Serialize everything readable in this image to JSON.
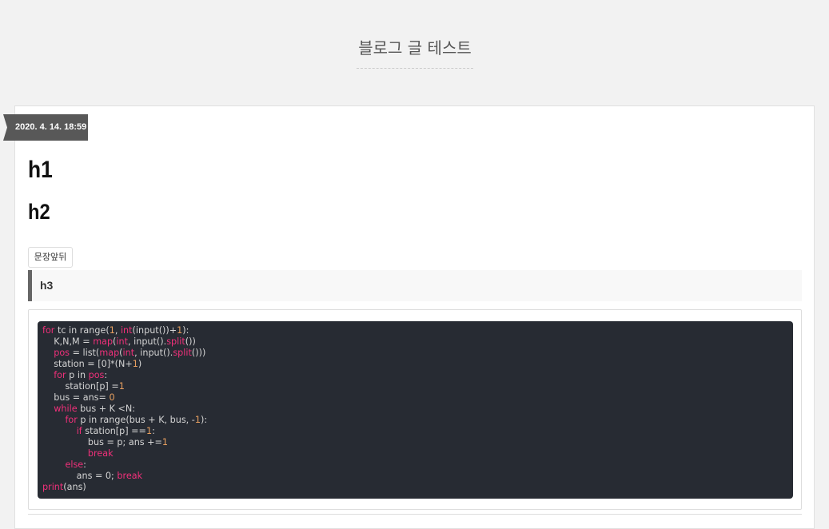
{
  "blog": {
    "title": "블로그 글 테스트"
  },
  "post": {
    "date": "2020. 4. 14. 18:59",
    "h1": "h1",
    "h2": "h2",
    "inline_text": "문장앞뒤",
    "h3": "h3"
  },
  "code": {
    "lines": [
      [
        [
          "kw",
          "for"
        ],
        [
          "t",
          " tc in range("
        ],
        [
          "num",
          "1"
        ],
        [
          "t",
          ", "
        ],
        [
          "kw",
          "int"
        ],
        [
          "t",
          "(input())+"
        ],
        [
          "num",
          "1"
        ],
        [
          "t",
          "):"
        ]
      ],
      [
        [
          "t",
          "    K,N,M = "
        ],
        [
          "kw",
          "map"
        ],
        [
          "t",
          "("
        ],
        [
          "kw",
          "int"
        ],
        [
          "t",
          ", input()."
        ],
        [
          "kw",
          "split"
        ],
        [
          "t",
          "())"
        ]
      ],
      [
        [
          "t",
          "    "
        ],
        [
          "kw",
          "pos"
        ],
        [
          "t",
          " = list("
        ],
        [
          "kw",
          "map"
        ],
        [
          "t",
          "("
        ],
        [
          "kw",
          "int"
        ],
        [
          "t",
          ", input()."
        ],
        [
          "kw",
          "split"
        ],
        [
          "t",
          "()))"
        ]
      ],
      [
        [
          "t",
          "    station = [0]*(N+"
        ],
        [
          "num",
          "1"
        ],
        [
          "t",
          ")"
        ]
      ],
      [
        [
          "t",
          "    "
        ],
        [
          "kw",
          "for"
        ],
        [
          "t",
          " p in "
        ],
        [
          "kw",
          "pos"
        ],
        [
          "t",
          ":"
        ]
      ],
      [
        [
          "t",
          "        station[p] ="
        ],
        [
          "num",
          "1"
        ]
      ],
      [
        [
          "t",
          "    bus = ans= "
        ],
        [
          "num",
          "0"
        ]
      ],
      [
        [
          "t",
          "    "
        ],
        [
          "kw",
          "while"
        ],
        [
          "t",
          " bus + K <N:"
        ]
      ],
      [
        [
          "t",
          "        "
        ],
        [
          "kw",
          "for"
        ],
        [
          "t",
          " p in range(bus + K, bus, -"
        ],
        [
          "num",
          "1"
        ],
        [
          "t",
          "):"
        ]
      ],
      [
        [
          "t",
          "            "
        ],
        [
          "kw",
          "if"
        ],
        [
          "t",
          " station[p] =="
        ],
        [
          "num",
          "1"
        ],
        [
          "t",
          ":"
        ]
      ],
      [
        [
          "t",
          "                bus = p; ans +="
        ],
        [
          "num",
          "1"
        ]
      ],
      [
        [
          "t",
          "                "
        ],
        [
          "kw",
          "break"
        ]
      ],
      [
        [
          "t",
          "        "
        ],
        [
          "kw",
          "else"
        ],
        [
          "t",
          ":"
        ]
      ],
      [
        [
          "t",
          "            ans = 0; "
        ],
        [
          "kw",
          "break"
        ]
      ],
      [
        [
          "kw",
          "print"
        ],
        [
          "t",
          "(ans)"
        ]
      ]
    ]
  },
  "colors": {
    "keyword": "#f0307a",
    "number": "#e8a060",
    "code_bg": "#272b33",
    "badge_bg": "#585858"
  }
}
